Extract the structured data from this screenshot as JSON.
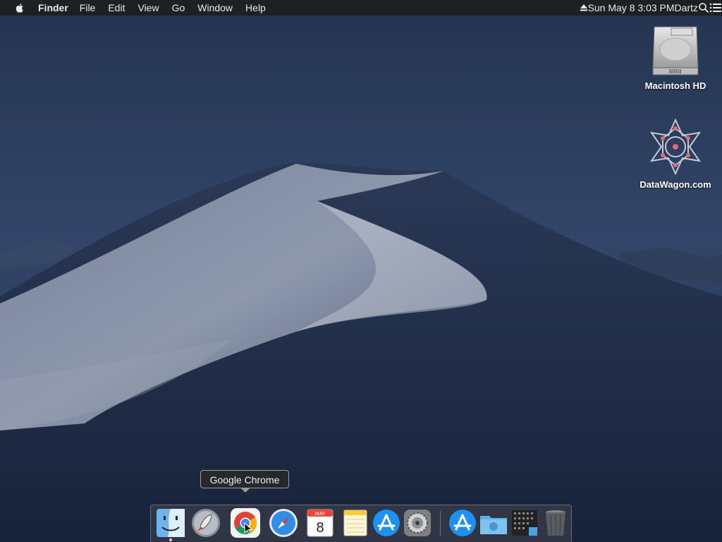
{
  "menubar": {
    "app_name": "Finder",
    "items": [
      "File",
      "Edit",
      "View",
      "Go",
      "Window",
      "Help"
    ],
    "clock": "Sun May 8  3:03 PM",
    "user": "Dartz"
  },
  "desktop": {
    "icons": [
      {
        "label": "Macintosh HD",
        "icon": "hard-drive-icon"
      },
      {
        "label": "DataWagon.com",
        "icon": "datawagon-icon"
      }
    ]
  },
  "tooltip": {
    "text": "Google Chrome"
  },
  "dock": {
    "items": [
      {
        "name": "Finder",
        "icon": "finder-icon",
        "running": true
      },
      {
        "name": "Launchpad",
        "icon": "launchpad-icon"
      },
      {
        "name": "Google Chrome",
        "icon": "chrome-icon"
      },
      {
        "name": "Safari",
        "icon": "safari-icon"
      },
      {
        "name": "Calendar",
        "icon": "calendar-icon",
        "month": "MAY",
        "day": "8"
      },
      {
        "name": "Notes",
        "icon": "notes-icon"
      },
      {
        "name": "App Store",
        "icon": "app-store-icon"
      },
      {
        "name": "System Preferences",
        "icon": "system-preferences-icon"
      },
      {
        "name": "Applications",
        "icon": "applications-stack-icon"
      },
      {
        "name": "Downloads",
        "icon": "downloads-folder-icon"
      },
      {
        "name": "Screenshots",
        "icon": "screenshots-stack-icon"
      },
      {
        "name": "Trash",
        "icon": "trash-icon"
      }
    ]
  }
}
